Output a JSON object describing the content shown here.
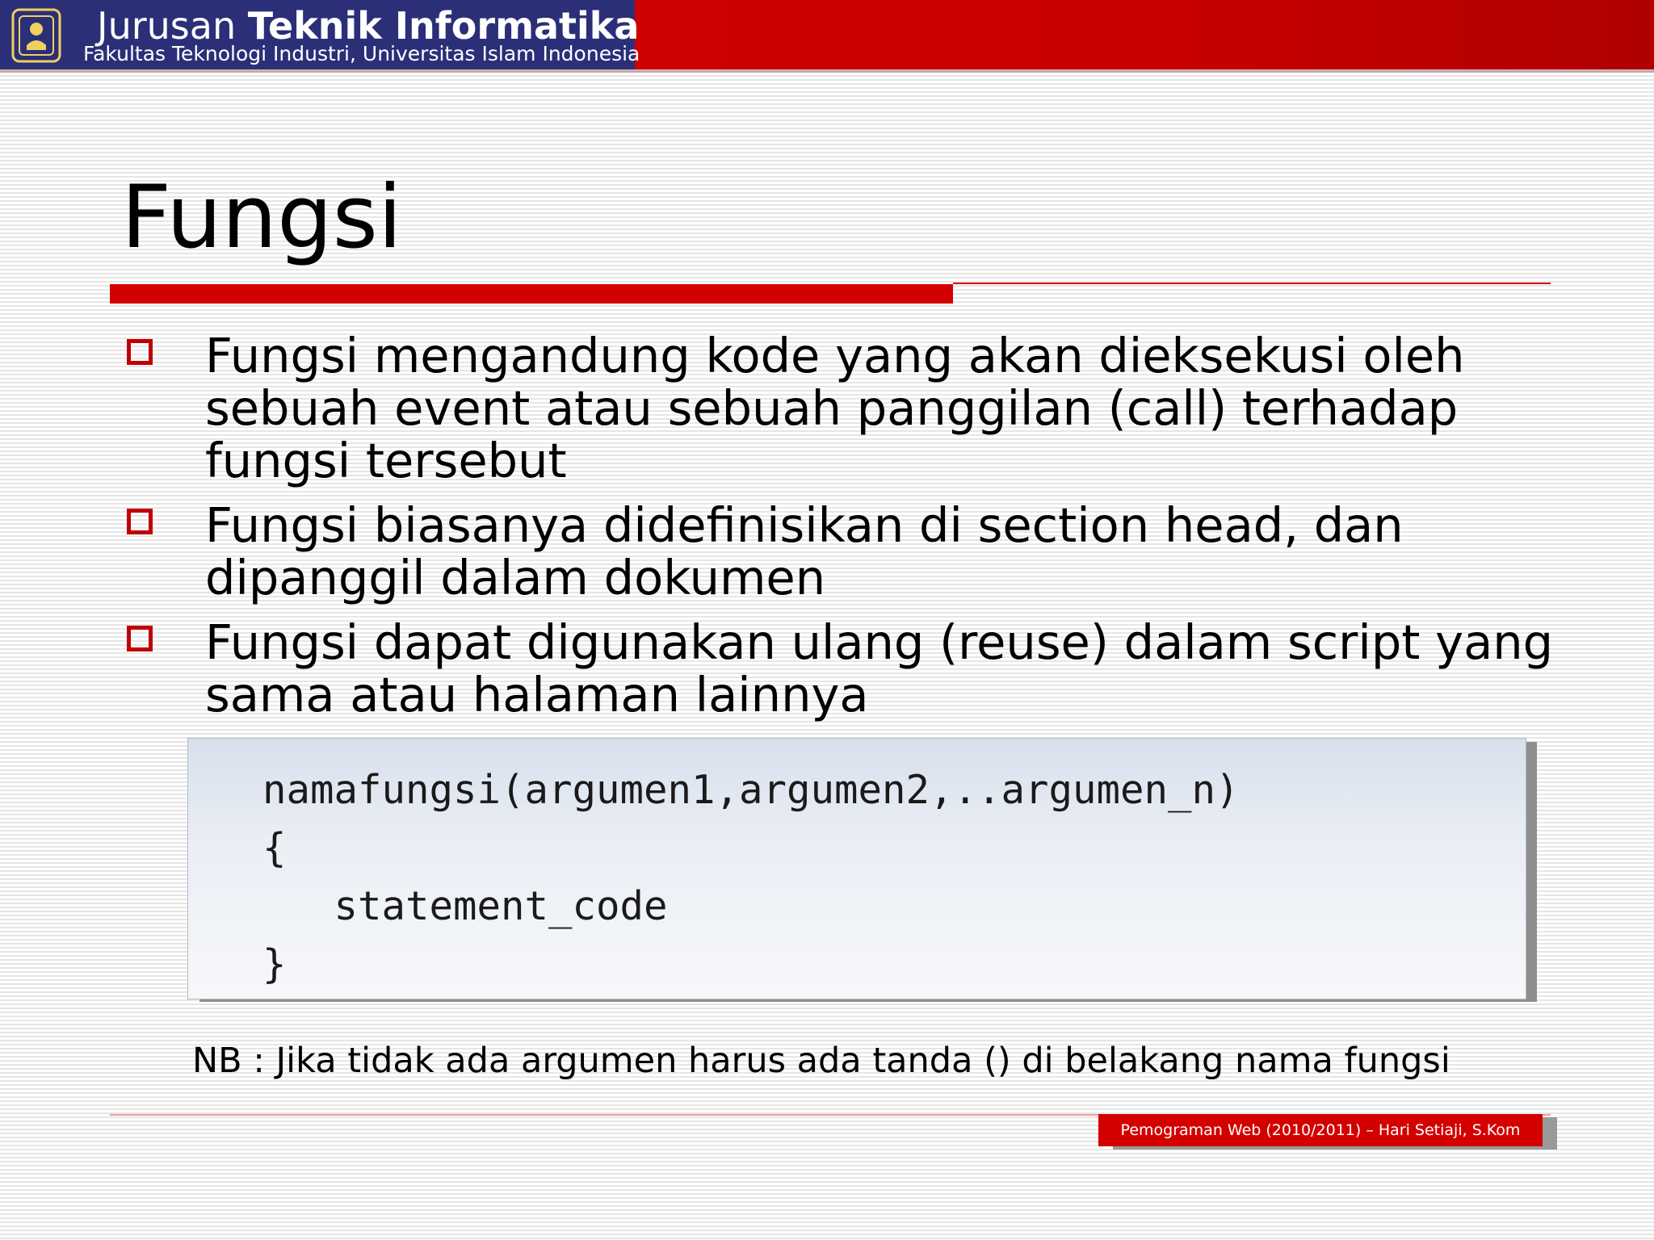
{
  "header": {
    "title_light": "Jurusan",
    "title_bold": "Teknik Informatika",
    "subtitle": "Fakultas Teknologi Industri, Universitas Islam Indonesia",
    "logo_icon": "university-emblem-icon",
    "band_color": "#2b2f78",
    "accent_color": "#d40000"
  },
  "slide": {
    "title": "Fungsi",
    "bullets": [
      {
        "text": "Fungsi mengandung kode yang akan dieksekusi oleh sebuah event atau sebuah panggilan (call) terhadap fungsi tersebut"
      },
      {
        "text": "Fungsi biasanya didefinisikan di section head, dan dipanggil dalam dokumen"
      },
      {
        "text": "Fungsi dapat digunakan ulang (reuse) dalam script yang sama atau halaman lainnya"
      }
    ],
    "bullet_icon": "hollow-square-bullet-icon",
    "code": {
      "line1": "namafungsi(argumen1,argumen2,..argumen_n)",
      "line2": "{",
      "line3": "   statement_code",
      "line4": "}"
    },
    "note": "NB : Jika tidak ada argumen harus ada tanda () di belakang nama fungsi"
  },
  "footer": {
    "label": "Pemograman Web (2010/2011) – Hari Setiaji, S.Kom"
  }
}
